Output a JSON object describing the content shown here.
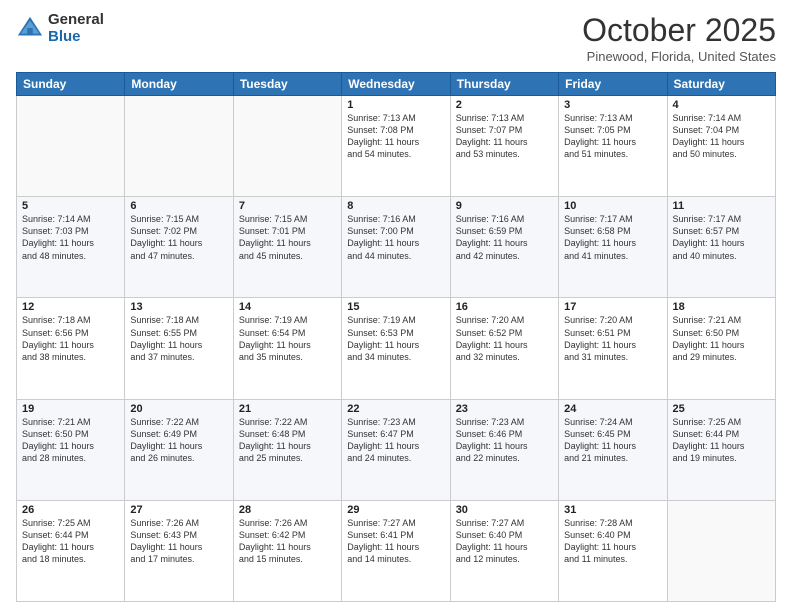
{
  "header": {
    "logo_general": "General",
    "logo_blue": "Blue",
    "month_title": "October 2025",
    "location": "Pinewood, Florida, United States"
  },
  "days_of_week": [
    "Sunday",
    "Monday",
    "Tuesday",
    "Wednesday",
    "Thursday",
    "Friday",
    "Saturday"
  ],
  "weeks": [
    [
      {
        "day": "",
        "info": ""
      },
      {
        "day": "",
        "info": ""
      },
      {
        "day": "",
        "info": ""
      },
      {
        "day": "1",
        "info": "Sunrise: 7:13 AM\nSunset: 7:08 PM\nDaylight: 11 hours\nand 54 minutes."
      },
      {
        "day": "2",
        "info": "Sunrise: 7:13 AM\nSunset: 7:07 PM\nDaylight: 11 hours\nand 53 minutes."
      },
      {
        "day": "3",
        "info": "Sunrise: 7:13 AM\nSunset: 7:05 PM\nDaylight: 11 hours\nand 51 minutes."
      },
      {
        "day": "4",
        "info": "Sunrise: 7:14 AM\nSunset: 7:04 PM\nDaylight: 11 hours\nand 50 minutes."
      }
    ],
    [
      {
        "day": "5",
        "info": "Sunrise: 7:14 AM\nSunset: 7:03 PM\nDaylight: 11 hours\nand 48 minutes."
      },
      {
        "day": "6",
        "info": "Sunrise: 7:15 AM\nSunset: 7:02 PM\nDaylight: 11 hours\nand 47 minutes."
      },
      {
        "day": "7",
        "info": "Sunrise: 7:15 AM\nSunset: 7:01 PM\nDaylight: 11 hours\nand 45 minutes."
      },
      {
        "day": "8",
        "info": "Sunrise: 7:16 AM\nSunset: 7:00 PM\nDaylight: 11 hours\nand 44 minutes."
      },
      {
        "day": "9",
        "info": "Sunrise: 7:16 AM\nSunset: 6:59 PM\nDaylight: 11 hours\nand 42 minutes."
      },
      {
        "day": "10",
        "info": "Sunrise: 7:17 AM\nSunset: 6:58 PM\nDaylight: 11 hours\nand 41 minutes."
      },
      {
        "day": "11",
        "info": "Sunrise: 7:17 AM\nSunset: 6:57 PM\nDaylight: 11 hours\nand 40 minutes."
      }
    ],
    [
      {
        "day": "12",
        "info": "Sunrise: 7:18 AM\nSunset: 6:56 PM\nDaylight: 11 hours\nand 38 minutes."
      },
      {
        "day": "13",
        "info": "Sunrise: 7:18 AM\nSunset: 6:55 PM\nDaylight: 11 hours\nand 37 minutes."
      },
      {
        "day": "14",
        "info": "Sunrise: 7:19 AM\nSunset: 6:54 PM\nDaylight: 11 hours\nand 35 minutes."
      },
      {
        "day": "15",
        "info": "Sunrise: 7:19 AM\nSunset: 6:53 PM\nDaylight: 11 hours\nand 34 minutes."
      },
      {
        "day": "16",
        "info": "Sunrise: 7:20 AM\nSunset: 6:52 PM\nDaylight: 11 hours\nand 32 minutes."
      },
      {
        "day": "17",
        "info": "Sunrise: 7:20 AM\nSunset: 6:51 PM\nDaylight: 11 hours\nand 31 minutes."
      },
      {
        "day": "18",
        "info": "Sunrise: 7:21 AM\nSunset: 6:50 PM\nDaylight: 11 hours\nand 29 minutes."
      }
    ],
    [
      {
        "day": "19",
        "info": "Sunrise: 7:21 AM\nSunset: 6:50 PM\nDaylight: 11 hours\nand 28 minutes."
      },
      {
        "day": "20",
        "info": "Sunrise: 7:22 AM\nSunset: 6:49 PM\nDaylight: 11 hours\nand 26 minutes."
      },
      {
        "day": "21",
        "info": "Sunrise: 7:22 AM\nSunset: 6:48 PM\nDaylight: 11 hours\nand 25 minutes."
      },
      {
        "day": "22",
        "info": "Sunrise: 7:23 AM\nSunset: 6:47 PM\nDaylight: 11 hours\nand 24 minutes."
      },
      {
        "day": "23",
        "info": "Sunrise: 7:23 AM\nSunset: 6:46 PM\nDaylight: 11 hours\nand 22 minutes."
      },
      {
        "day": "24",
        "info": "Sunrise: 7:24 AM\nSunset: 6:45 PM\nDaylight: 11 hours\nand 21 minutes."
      },
      {
        "day": "25",
        "info": "Sunrise: 7:25 AM\nSunset: 6:44 PM\nDaylight: 11 hours\nand 19 minutes."
      }
    ],
    [
      {
        "day": "26",
        "info": "Sunrise: 7:25 AM\nSunset: 6:44 PM\nDaylight: 11 hours\nand 18 minutes."
      },
      {
        "day": "27",
        "info": "Sunrise: 7:26 AM\nSunset: 6:43 PM\nDaylight: 11 hours\nand 17 minutes."
      },
      {
        "day": "28",
        "info": "Sunrise: 7:26 AM\nSunset: 6:42 PM\nDaylight: 11 hours\nand 15 minutes."
      },
      {
        "day": "29",
        "info": "Sunrise: 7:27 AM\nSunset: 6:41 PM\nDaylight: 11 hours\nand 14 minutes."
      },
      {
        "day": "30",
        "info": "Sunrise: 7:27 AM\nSunset: 6:40 PM\nDaylight: 11 hours\nand 12 minutes."
      },
      {
        "day": "31",
        "info": "Sunrise: 7:28 AM\nSunset: 6:40 PM\nDaylight: 11 hours\nand 11 minutes."
      },
      {
        "day": "",
        "info": ""
      }
    ]
  ]
}
